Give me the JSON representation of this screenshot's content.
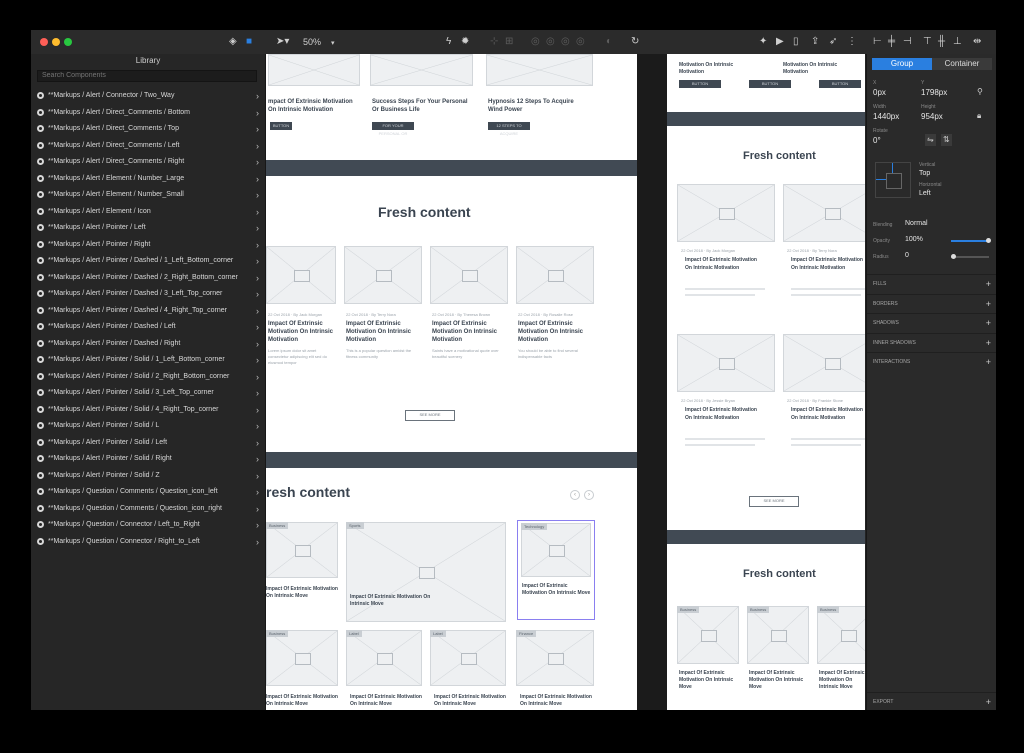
{
  "window": {
    "zoom": "50%"
  },
  "library": {
    "title": "Library",
    "search_placeholder": "Search Components",
    "items": [
      "**Markups / Alert / Connector / Two_Way",
      "**Markups / Alert / Direct_Comments / Bottom",
      "**Markups / Alert / Direct_Comments / Top",
      "**Markups / Alert / Direct_Comments / Left",
      "**Markups / Alert / Direct_Comments / Right",
      "**Markups / Alert / Element / Number_Large",
      "**Markups / Alert / Element / Number_Small",
      "**Markups / Alert / Element / Icon",
      "**Markups / Alert / Pointer / Left",
      "**Markups / Alert / Pointer / Right",
      "**Markups / Alert / Pointer / Dashed / 1_Left_Bottom_corner",
      "**Markups / Alert / Pointer / Dashed / 2_Right_Bottom_corner",
      "**Markups / Alert / Pointer / Dashed / 3_Left_Top_corner",
      "**Markups / Alert / Pointer / Dashed / 4_Right_Top_corner",
      "**Markups / Alert / Pointer / Dashed / Left",
      "**Markups / Alert / Pointer / Dashed / Right",
      "**Markups / Alert / Pointer / Solid / 1_Left_Bottom_corner",
      "**Markups / Alert / Pointer / Solid / 2_Right_Bottom_corner",
      "**Markups / Alert / Pointer / Solid / 3_Left_Top_corner",
      "**Markups / Alert / Pointer / Solid / 4_Right_Top_corner",
      "**Markups / Alert / Pointer / Solid / L",
      "**Markups / Alert / Pointer / Solid / Left",
      "**Markups / Alert / Pointer / Solid / Right",
      "**Markups / Alert / Pointer / Solid / Z",
      "**Markups / Question / Comments / Question_icon_left",
      "**Markups / Question / Comments / Question_icon_right",
      "**Markups / Question / Connector / Left_to_Right",
      "**Markups / Question / Connector / Right_to_Left"
    ]
  },
  "canvas": {
    "top_cards": [
      {
        "title": "mpact Of Extrinsic Motivation On Intrinsic Motivation",
        "button": "BUTTON"
      },
      {
        "title": "Success Steps For Your Personal Or Business Life",
        "button": "FOR YOUR PERSONAL OR"
      },
      {
        "title": "Hypnosis 12 Steps To Acquire Wind Power",
        "button": "12 STEPS TO ACQUIRE"
      }
    ],
    "fresh_title": "Fresh content",
    "fresh_cards": [
      {
        "meta": "22 Oct 2018  ·  By Jack Morgan",
        "title": "Impact Of Extrinsic Motivation On Intrinsic Motivation",
        "body": "Lorem ipsum dolor sit amet consectetur adipiscing elit sed do eiusmod tempor"
      },
      {
        "meta": "22 Oct 2018  ·  By Terry Nora",
        "title": "Impact Of Extrinsic Motivation On Intrinsic Motivation",
        "body": "This is a popular question amidst the fitness community"
      },
      {
        "meta": "22 Oct 2018  ·  By Theresa Brown",
        "title": "Impact Of Extrinsic Motivation On Intrinsic Motivation",
        "body": "Saints have a motivational quote over beautiful scenery"
      },
      {
        "meta": "22 Oct 2018  ·  By Rosalie Rose",
        "title": "Impact Of Extrinsic Motivation On Intrinsic Motivation",
        "body": "You should be able to find several indispensable facts"
      }
    ],
    "see_more": "SEE MORE",
    "fresh_title_cut": "resh content",
    "grid_tags": [
      "Business",
      "Sports",
      "Technology",
      "Business",
      "Label",
      "Label",
      "Finance"
    ],
    "grid_title": "Impact Of Extrinsic Motivation On Intrinsic Move",
    "right_top_title": "Motivation On Intrinsic Motivation",
    "right_buttons": [
      "BUTTON",
      "BUTTON",
      "BUTTON"
    ],
    "right_fresh_title": "Fresh content",
    "right_cards": [
      {
        "meta": "22 Oct 2018  ·  By Jack Morgan",
        "title": "Impact Of Extrinsic Motivation On Intrinsic Motivation"
      },
      {
        "meta": "22 Oct 2018  ·  By Terry Nora",
        "title": "Impact Of Extrinsic Motivation On Intrinsic Motivation"
      },
      {
        "meta": "22 Oct 2018  ·  By Jessie Bryan",
        "title": "Impact Of Extrinsic Motivation On Intrinsic Motivation"
      },
      {
        "meta": "22 Oct 2018  ·  By Frankie Stone",
        "title": "Impact Of Extrinsic Motivation On Intrinsic Motivation"
      }
    ],
    "right_see_more": "SEE MORE",
    "right_fresh_title_2": "Fresh content",
    "right_tags": [
      "Business",
      "Business",
      "Business"
    ]
  },
  "inspector": {
    "tab_group": "Group",
    "tab_container": "Container",
    "x_label": "X",
    "x_value": "0px",
    "y_label": "Y",
    "y_value": "1798px",
    "width_label": "Width",
    "width_value": "1440px",
    "height_label": "Height",
    "height_value": "954px",
    "rotate_label": "Rotate",
    "rotate_value": "0°",
    "vertical_label": "Vertical",
    "vertical_value": "Top",
    "horizontal_label": "Horizontal",
    "horizontal_value": "Left",
    "blending_label": "Blending",
    "blending_value": "Normal",
    "opacity_label": "Opacity",
    "opacity_value": "100%",
    "opacity_fraction": 1.0,
    "radius_label": "Radius",
    "radius_value": "0",
    "sections": [
      "FILLS",
      "BORDERS",
      "SHADOWS",
      "INNER SHADOWS",
      "INTERACTIONS"
    ],
    "export_label": "EXPORT"
  },
  "colors": {
    "accent_blue": "#2a7fe0",
    "selection_purple": "#8a7ff0",
    "band_dark": "#414a54",
    "traffic_close": "#ff5f57",
    "traffic_min": "#febc2e",
    "traffic_max": "#28c840"
  },
  "icons": [
    "pointer-icon",
    "gear-icon",
    "lightning-icon",
    "refresh-icon",
    "play-icon",
    "phone-preview-icon",
    "share-icon",
    "rocket-icon",
    "more-icon",
    "align-icon"
  ]
}
